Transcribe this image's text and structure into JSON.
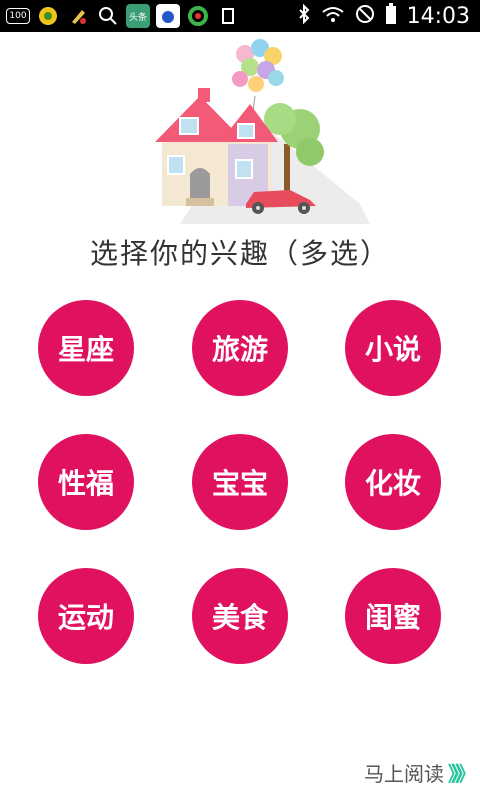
{
  "status_bar": {
    "time": "14:03",
    "left_icons": [
      "battery-badge-icon",
      "app-icon-yellow",
      "cleaner-icon",
      "search-icon",
      "news-app-icon",
      "baidu-icon",
      "browser-icon",
      "sim-icon"
    ],
    "right_icons": [
      "bluetooth-icon",
      "wifi-icon",
      "do-not-disturb-icon",
      "battery-icon"
    ],
    "battery_badge": "100"
  },
  "title": "选择你的兴趣（多选）",
  "interests": [
    {
      "label": "星座"
    },
    {
      "label": "旅游"
    },
    {
      "label": "小说"
    },
    {
      "label": "性福"
    },
    {
      "label": "宝宝"
    },
    {
      "label": "化妆"
    },
    {
      "label": "运动"
    },
    {
      "label": "美食"
    },
    {
      "label": "闺蜜"
    }
  ],
  "cta": {
    "label": "马上阅读",
    "arrows": "》》》"
  },
  "colors": {
    "accent": "#e0115f",
    "cta_arrow": "#2cc4a0"
  }
}
